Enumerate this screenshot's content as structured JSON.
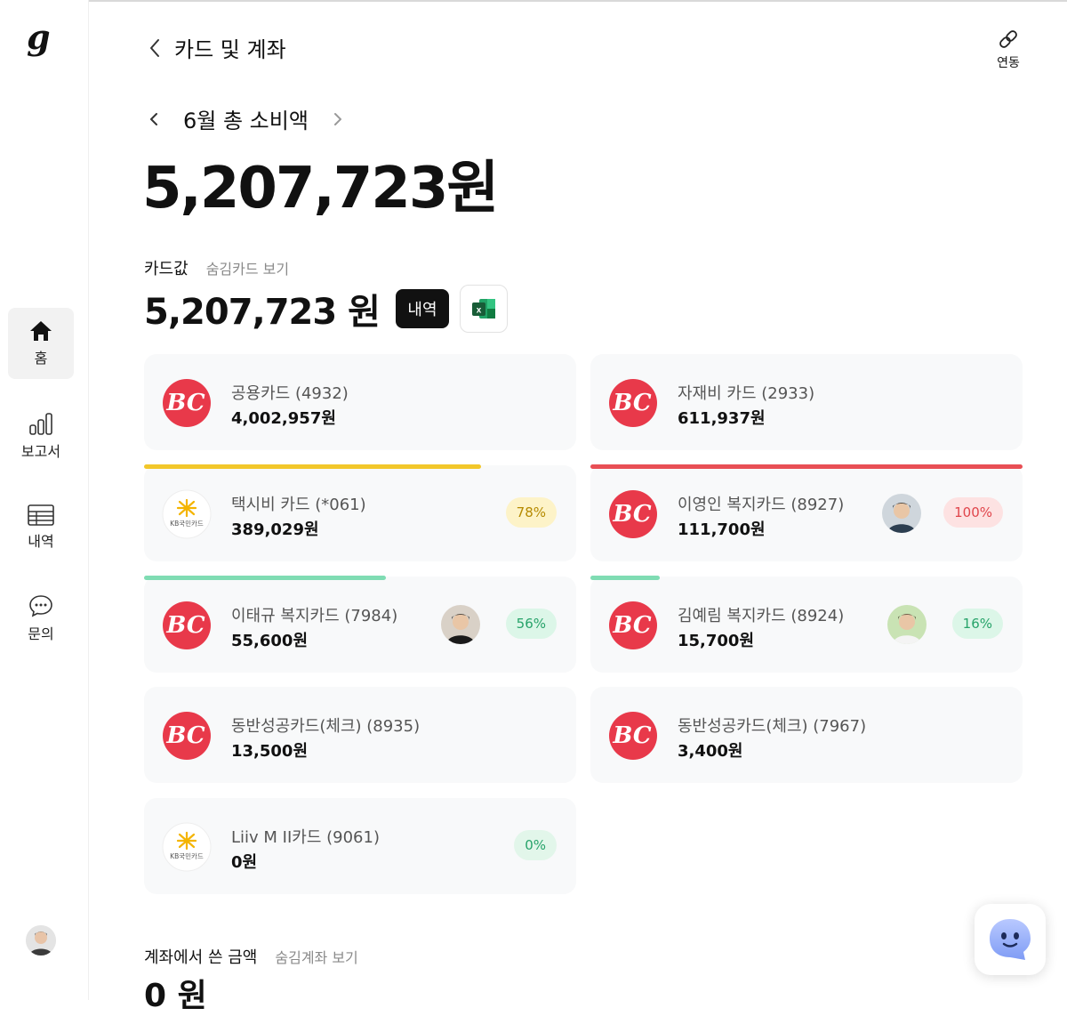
{
  "sidebar": {
    "logo": "g",
    "items": [
      {
        "label": "홈",
        "icon": "home-icon"
      },
      {
        "label": "보고서",
        "icon": "bar-chart-icon"
      },
      {
        "label": "내역",
        "icon": "table-icon"
      },
      {
        "label": "문의",
        "icon": "chat-bubble-icon"
      }
    ]
  },
  "header": {
    "title": "카드 및 계좌",
    "link_label": "연동"
  },
  "month": {
    "title": "6월 총 소비액",
    "total": "5,207,723원"
  },
  "cards_section": {
    "heading": "카드값",
    "hidden_link": "숨김카드 보기",
    "total": "5,207,723 원",
    "history_label": "내역",
    "excel_icon_letter": "x"
  },
  "cards": [
    {
      "name": "공용카드 (4932)",
      "amount": "4,002,957원",
      "issuer": "BC"
    },
    {
      "name": "자재비 카드 (2933)",
      "amount": "611,937원",
      "issuer": "BC"
    },
    {
      "name": "택시비 카드 (*061)",
      "amount": "389,029원",
      "issuer": "KB",
      "percent": "78%",
      "progress": 0.78,
      "bar_color": "#f2c72a",
      "badge_bg": "#fdf3c8",
      "badge_color": "#b58a00"
    },
    {
      "name": "이영인 복지카드 (8927)",
      "amount": "111,700원",
      "issuer": "BC",
      "percent": "100%",
      "progress": 1.0,
      "bar_color": "#e84f55",
      "badge_bg": "#fde2e2",
      "badge_color": "#e0454b",
      "has_person": true
    },
    {
      "name": "이태규 복지카드 (7984)",
      "amount": "55,600원",
      "issuer": "BC",
      "percent": "56%",
      "progress": 0.56,
      "bar_color": "#7fdcb3",
      "badge_bg": "#dcf6e8",
      "badge_color": "#27a36a",
      "has_person": true
    },
    {
      "name": "김예림 복지카드 (8924)",
      "amount": "15,700원",
      "issuer": "BC",
      "percent": "16%",
      "progress": 0.16,
      "bar_color": "#7fdcb3",
      "badge_bg": "#dcf6e8",
      "badge_color": "#27a36a",
      "has_person": true
    },
    {
      "name": "동반성공카드(체크) (8935)",
      "amount": "13,500원",
      "issuer": "BC"
    },
    {
      "name": "동반성공카드(체크) (7967)",
      "amount": "3,400원",
      "issuer": "BC"
    },
    {
      "name": "Liiv M II카드 (9061)",
      "amount": "0원",
      "issuer": "KB",
      "percent": "0%",
      "progress": 0,
      "badge_bg": "#e2f6ea",
      "badge_color": "#27a36a"
    }
  ],
  "kb_logo_text": "KB국민카드",
  "account_section": {
    "heading": "계좌에서 쓴 금액",
    "hidden_link": "숨김계좌 보기",
    "total": "0 원"
  },
  "colors": {
    "bc_red": "#e8394a",
    "kb_yellow": "#f4b400"
  }
}
